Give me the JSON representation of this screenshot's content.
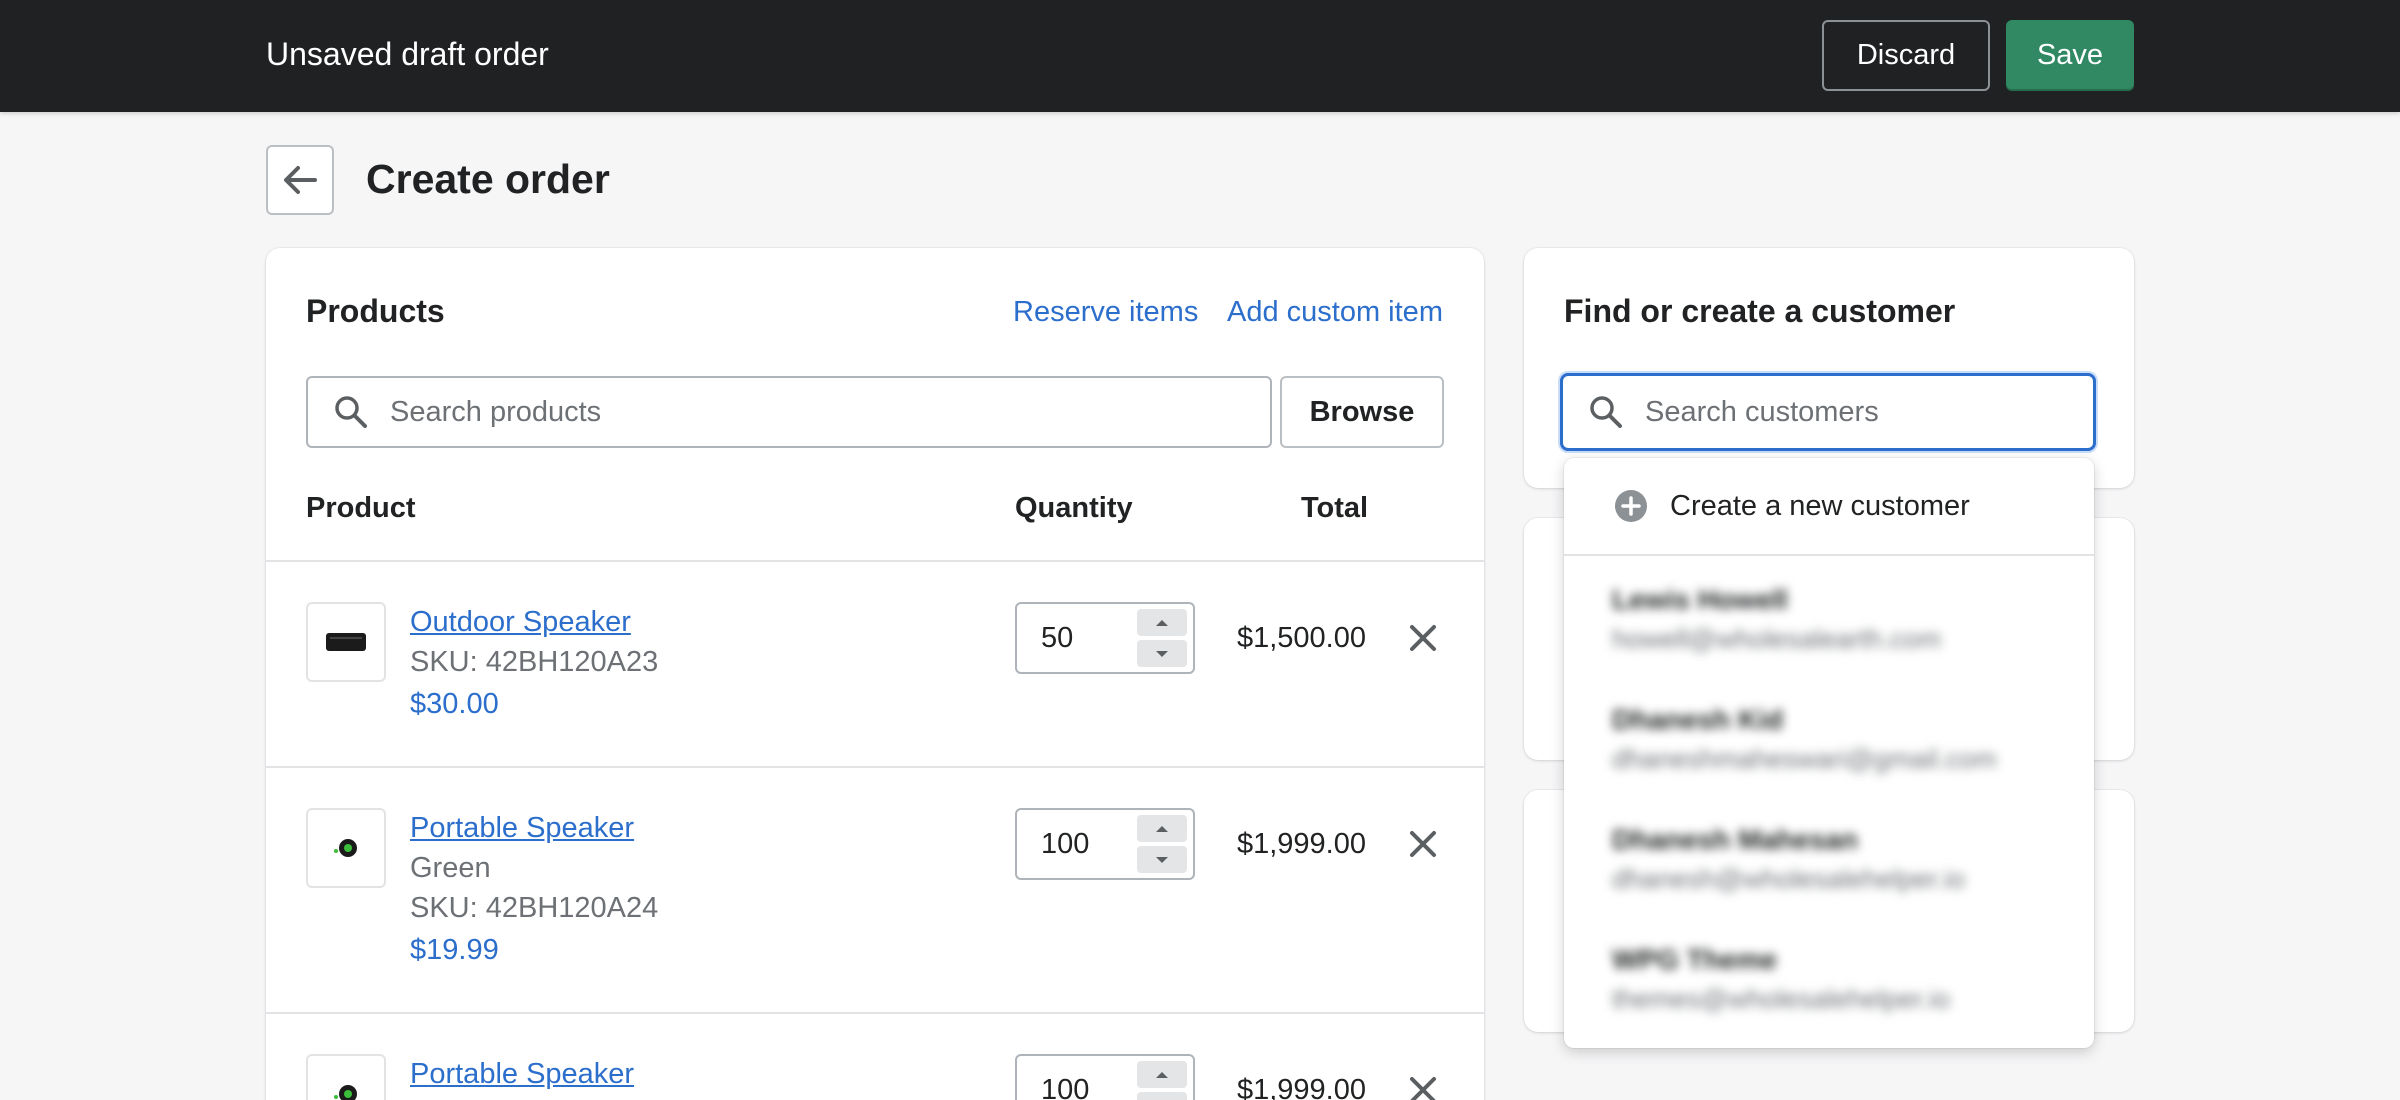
{
  "topbar": {
    "title": "Unsaved draft order",
    "discard_label": "Discard",
    "save_label": "Save",
    "save_color": "#308963"
  },
  "page": {
    "title": "Create order",
    "back_icon": "arrow-left-icon"
  },
  "products": {
    "heading": "Products",
    "reserve_items_label": "Reserve items",
    "add_custom_item_label": "Add custom item",
    "search_placeholder": "Search products",
    "browse_label": "Browse",
    "columns": {
      "product": "Product",
      "quantity": "Quantity",
      "total": "Total"
    },
    "items": [
      {
        "name": "Outdoor Speaker",
        "variant": "",
        "sku": "SKU: 42BH120A23",
        "price": "$30.00",
        "quantity": "50",
        "total": "$1,500.00",
        "thumb_icon": "black-speaker-icon"
      },
      {
        "name": "Portable Speaker",
        "variant": "Green",
        "sku": "SKU: 42BH120A24",
        "price": "$19.99",
        "quantity": "100",
        "total": "$1,999.00",
        "thumb_icon": "green-speaker-icon"
      },
      {
        "name": "Portable Speaker",
        "quantity": "100",
        "total": "$1,999.00",
        "thumb_icon": "green-speaker-icon"
      }
    ]
  },
  "customer": {
    "heading": "Find or create a customer",
    "search_placeholder": "Search customers",
    "create_new_label": "Create a new customer",
    "results": [
      {
        "name": "Lewis Howell",
        "email": "howell@wholesalearth.com"
      },
      {
        "name": "Dhanesh Kid",
        "email": "dhaneshmaheswari@gmail.com"
      },
      {
        "name": "Dhanesh Mahesan",
        "email": "dhanesh@wholesalehelper.io"
      },
      {
        "name": "WPG Theme",
        "email": "themes@wholesalehelper.io"
      }
    ]
  },
  "colors": {
    "link": "#2c6ecb",
    "topbar_bg": "#202123",
    "focus_border": "#2c6ecb"
  }
}
